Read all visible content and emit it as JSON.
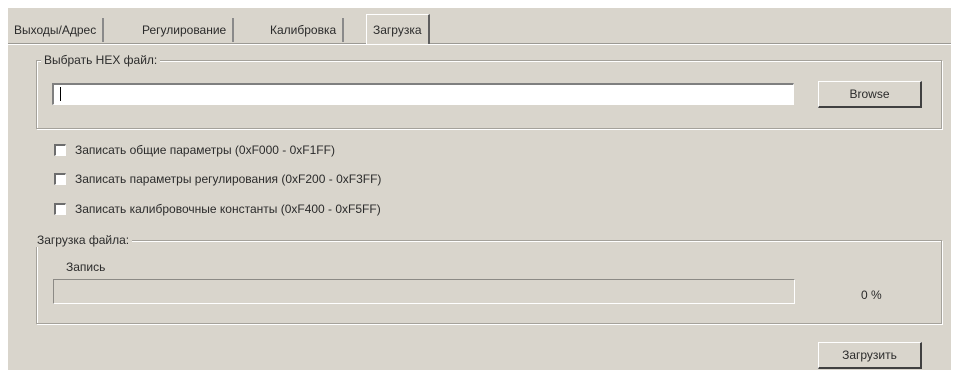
{
  "tabs": [
    {
      "label": "Выходы/Адрес",
      "active": false
    },
    {
      "label": "Регулирование",
      "active": false
    },
    {
      "label": "Калибровка",
      "active": false
    },
    {
      "label": "Загрузка",
      "active": true
    }
  ],
  "hex_file": {
    "group_label": "Выбрать HEX файл:",
    "path_value": "",
    "browse_label": "Browse"
  },
  "options": [
    {
      "label": "Записать общие параметры (0xF000 - 0xF1FF)",
      "checked": false
    },
    {
      "label": "Записать параметры регулирования (0xF200 - 0xF3FF)",
      "checked": false
    },
    {
      "label": "Записать калибровочные константы (0xF400 - 0xF5FF)",
      "checked": false
    }
  ],
  "upload": {
    "group_label": "Загрузка файла:",
    "status_text": "Запись",
    "progress_fraction": 0,
    "percent_text": "0 %"
  },
  "actions": {
    "upload_label": "Загрузить"
  },
  "colors": {
    "panel": "#d9d5cc",
    "progress_fill": "#0a246a"
  }
}
